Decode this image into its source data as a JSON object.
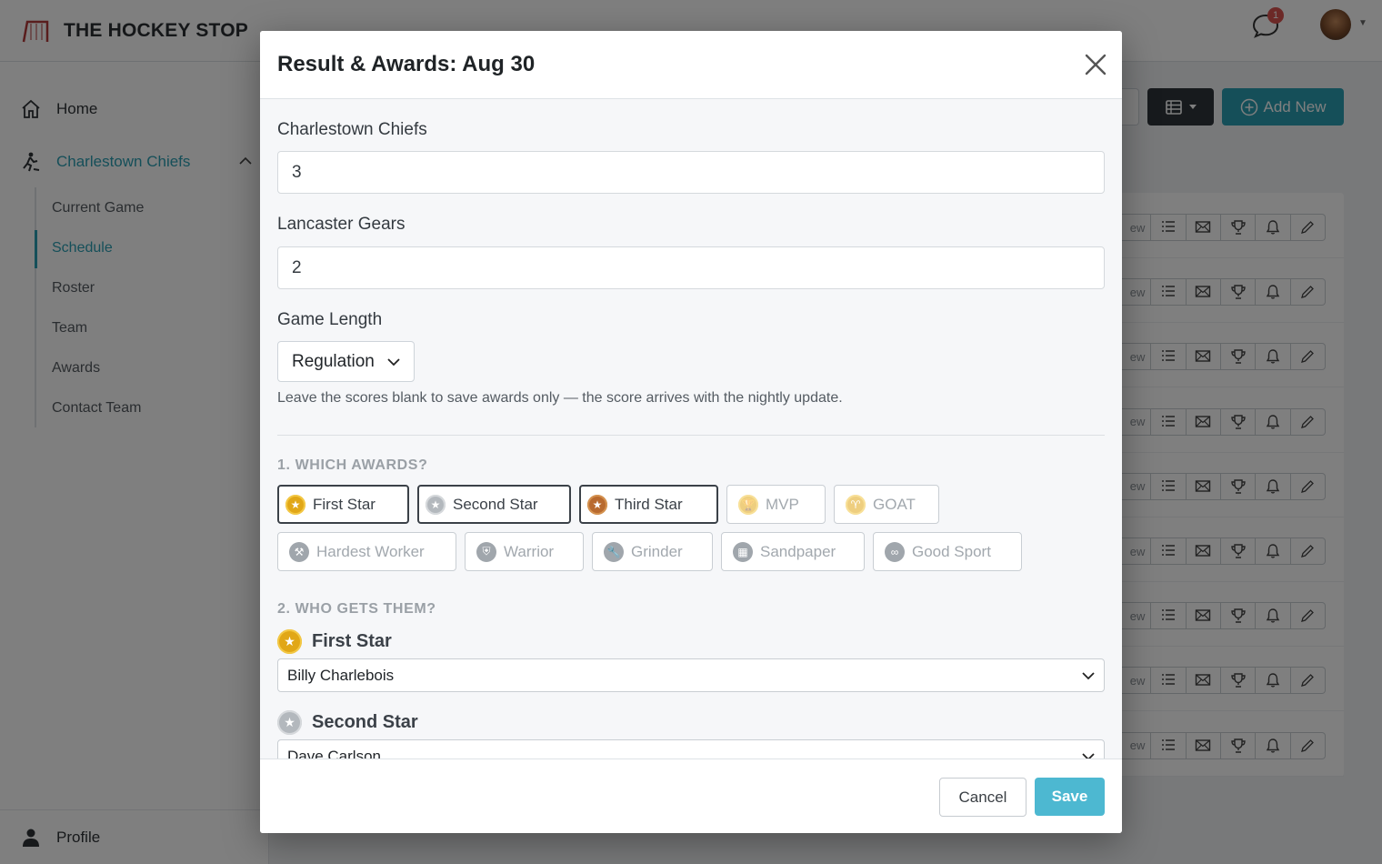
{
  "app": {
    "brand": "THE HOCKEY STOP",
    "notifications_count": "1"
  },
  "sidebar": {
    "home": "Home",
    "team": "Charlestown Chiefs",
    "items": [
      "Current Game",
      "Schedule",
      "Roster",
      "Team",
      "Awards",
      "Contact Team"
    ],
    "active_item": "Schedule",
    "profile": "Profile"
  },
  "background": {
    "add_new": "Add New",
    "row_view_text": "ew",
    "row_count": 9
  },
  "modal": {
    "title": "Result & Awards: Aug 30",
    "team1_label": "Charlestown Chiefs",
    "team1_score": "3",
    "team2_label": "Lancaster Gears",
    "team2_score": "2",
    "game_length_label": "Game Length",
    "game_length_value": "Regulation",
    "help_text": "Leave the scores blank to save awards only — the score arrives with the nightly update.",
    "awards_heading": "1. WHICH AWARDS?",
    "awards": [
      {
        "label": "First Star",
        "icon": "star-icon",
        "selected": true
      },
      {
        "label": "Second Star",
        "icon": "star-icon",
        "selected": true
      },
      {
        "label": "Third Star",
        "icon": "star-icon",
        "selected": true
      },
      {
        "label": "MVP",
        "icon": "trophy-icon",
        "selected": false
      },
      {
        "label": "GOAT",
        "icon": "goat-icon",
        "selected": false
      },
      {
        "label": "Hardest Worker",
        "icon": "hammer-icon",
        "selected": false
      },
      {
        "label": "Warrior",
        "icon": "shield-icon",
        "selected": false
      },
      {
        "label": "Grinder",
        "icon": "wrench-icon",
        "selected": false
      },
      {
        "label": "Sandpaper",
        "icon": "sandpaper-icon",
        "selected": false
      },
      {
        "label": "Good Sport",
        "icon": "handshake-icon",
        "selected": false
      }
    ],
    "who_heading": "2. WHO GETS THEM?",
    "assignments": [
      {
        "award": "First Star",
        "player": "Billy Charlebois"
      },
      {
        "award": "Second Star",
        "player": "Dave Carlson"
      }
    ],
    "cancel": "Cancel",
    "save": "Save"
  },
  "colors": {
    "accent": "#2b9fb3",
    "save_button": "#4db8d1",
    "gold": "#e1a717",
    "silver": "#b3b8bd",
    "bronze": "#b86a2f"
  }
}
